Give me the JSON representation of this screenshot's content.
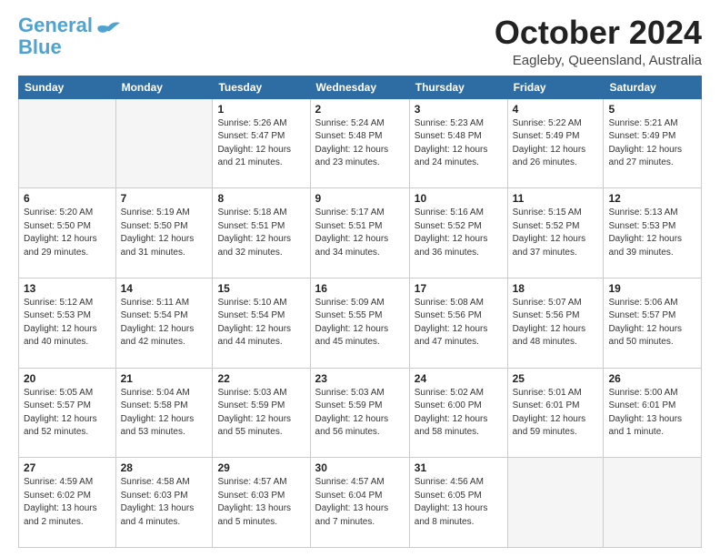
{
  "header": {
    "logo_line1": "General",
    "logo_line2": "Blue",
    "month": "October 2024",
    "location": "Eagleby, Queensland, Australia"
  },
  "weekdays": [
    "Sunday",
    "Monday",
    "Tuesday",
    "Wednesday",
    "Thursday",
    "Friday",
    "Saturday"
  ],
  "weeks": [
    [
      {
        "day": "",
        "detail": ""
      },
      {
        "day": "",
        "detail": ""
      },
      {
        "day": "1",
        "detail": "Sunrise: 5:26 AM\nSunset: 5:47 PM\nDaylight: 12 hours and 21 minutes."
      },
      {
        "day": "2",
        "detail": "Sunrise: 5:24 AM\nSunset: 5:48 PM\nDaylight: 12 hours and 23 minutes."
      },
      {
        "day": "3",
        "detail": "Sunrise: 5:23 AM\nSunset: 5:48 PM\nDaylight: 12 hours and 24 minutes."
      },
      {
        "day": "4",
        "detail": "Sunrise: 5:22 AM\nSunset: 5:49 PM\nDaylight: 12 hours and 26 minutes."
      },
      {
        "day": "5",
        "detail": "Sunrise: 5:21 AM\nSunset: 5:49 PM\nDaylight: 12 hours and 27 minutes."
      }
    ],
    [
      {
        "day": "6",
        "detail": "Sunrise: 5:20 AM\nSunset: 5:50 PM\nDaylight: 12 hours and 29 minutes."
      },
      {
        "day": "7",
        "detail": "Sunrise: 5:19 AM\nSunset: 5:50 PM\nDaylight: 12 hours and 31 minutes."
      },
      {
        "day": "8",
        "detail": "Sunrise: 5:18 AM\nSunset: 5:51 PM\nDaylight: 12 hours and 32 minutes."
      },
      {
        "day": "9",
        "detail": "Sunrise: 5:17 AM\nSunset: 5:51 PM\nDaylight: 12 hours and 34 minutes."
      },
      {
        "day": "10",
        "detail": "Sunrise: 5:16 AM\nSunset: 5:52 PM\nDaylight: 12 hours and 36 minutes."
      },
      {
        "day": "11",
        "detail": "Sunrise: 5:15 AM\nSunset: 5:52 PM\nDaylight: 12 hours and 37 minutes."
      },
      {
        "day": "12",
        "detail": "Sunrise: 5:13 AM\nSunset: 5:53 PM\nDaylight: 12 hours and 39 minutes."
      }
    ],
    [
      {
        "day": "13",
        "detail": "Sunrise: 5:12 AM\nSunset: 5:53 PM\nDaylight: 12 hours and 40 minutes."
      },
      {
        "day": "14",
        "detail": "Sunrise: 5:11 AM\nSunset: 5:54 PM\nDaylight: 12 hours and 42 minutes."
      },
      {
        "day": "15",
        "detail": "Sunrise: 5:10 AM\nSunset: 5:54 PM\nDaylight: 12 hours and 44 minutes."
      },
      {
        "day": "16",
        "detail": "Sunrise: 5:09 AM\nSunset: 5:55 PM\nDaylight: 12 hours and 45 minutes."
      },
      {
        "day": "17",
        "detail": "Sunrise: 5:08 AM\nSunset: 5:56 PM\nDaylight: 12 hours and 47 minutes."
      },
      {
        "day": "18",
        "detail": "Sunrise: 5:07 AM\nSunset: 5:56 PM\nDaylight: 12 hours and 48 minutes."
      },
      {
        "day": "19",
        "detail": "Sunrise: 5:06 AM\nSunset: 5:57 PM\nDaylight: 12 hours and 50 minutes."
      }
    ],
    [
      {
        "day": "20",
        "detail": "Sunrise: 5:05 AM\nSunset: 5:57 PM\nDaylight: 12 hours and 52 minutes."
      },
      {
        "day": "21",
        "detail": "Sunrise: 5:04 AM\nSunset: 5:58 PM\nDaylight: 12 hours and 53 minutes."
      },
      {
        "day": "22",
        "detail": "Sunrise: 5:03 AM\nSunset: 5:59 PM\nDaylight: 12 hours and 55 minutes."
      },
      {
        "day": "23",
        "detail": "Sunrise: 5:03 AM\nSunset: 5:59 PM\nDaylight: 12 hours and 56 minutes."
      },
      {
        "day": "24",
        "detail": "Sunrise: 5:02 AM\nSunset: 6:00 PM\nDaylight: 12 hours and 58 minutes."
      },
      {
        "day": "25",
        "detail": "Sunrise: 5:01 AM\nSunset: 6:01 PM\nDaylight: 12 hours and 59 minutes."
      },
      {
        "day": "26",
        "detail": "Sunrise: 5:00 AM\nSunset: 6:01 PM\nDaylight: 13 hours and 1 minute."
      }
    ],
    [
      {
        "day": "27",
        "detail": "Sunrise: 4:59 AM\nSunset: 6:02 PM\nDaylight: 13 hours and 2 minutes."
      },
      {
        "day": "28",
        "detail": "Sunrise: 4:58 AM\nSunset: 6:03 PM\nDaylight: 13 hours and 4 minutes."
      },
      {
        "day": "29",
        "detail": "Sunrise: 4:57 AM\nSunset: 6:03 PM\nDaylight: 13 hours and 5 minutes."
      },
      {
        "day": "30",
        "detail": "Sunrise: 4:57 AM\nSunset: 6:04 PM\nDaylight: 13 hours and 7 minutes."
      },
      {
        "day": "31",
        "detail": "Sunrise: 4:56 AM\nSunset: 6:05 PM\nDaylight: 13 hours and 8 minutes."
      },
      {
        "day": "",
        "detail": ""
      },
      {
        "day": "",
        "detail": ""
      }
    ]
  ]
}
